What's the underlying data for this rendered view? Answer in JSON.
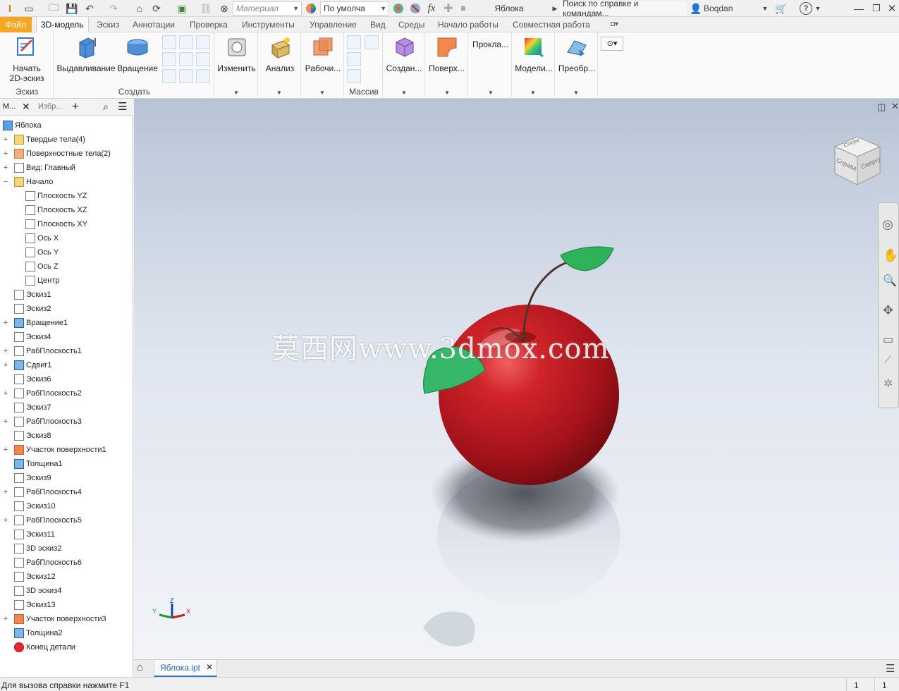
{
  "titlebar": {
    "material": "Материал",
    "appearance": "По умолча",
    "fx": "fx",
    "doc_title": "Яблока",
    "search_placeholder": "Поиск по справке и командам...",
    "user": "Boqdan"
  },
  "tabs": [
    "Файл",
    "3D-модель",
    "Эскиз",
    "Аннотации",
    "Проверка",
    "Инструменты",
    "Управление",
    "Вид",
    "Среды",
    "Начало работы",
    "Совместная работа"
  ],
  "ribbon": {
    "start_sketch": "Начать\n2D-эскиз",
    "sketch_panel": "Эскиз",
    "extrude": "Выдавливание",
    "revolve": "Вращение",
    "create_panel": "Создать",
    "modify": "Изменить",
    "analysis": "Анализ",
    "work": "Рабочи...",
    "pattern": "Массив",
    "create2": "Создан...",
    "surface": "Поверх...",
    "route": "Прокла...",
    "model": "Модели...",
    "convert": "Преобр..."
  },
  "browser": {
    "tab1": "М...",
    "tab2": "Избр...",
    "items": [
      {
        "label": "Яблока",
        "level": 0,
        "exp": ""
      },
      {
        "label": "Твердые тела(4)",
        "level": 1,
        "exp": "+"
      },
      {
        "label": "Поверхностные тела(2)",
        "level": 1,
        "exp": "+"
      },
      {
        "label": "Вид: Главный",
        "level": 1,
        "exp": "+"
      },
      {
        "label": "Начало",
        "level": 1,
        "exp": "−"
      },
      {
        "label": "Плоскость YZ",
        "level": 2,
        "exp": ""
      },
      {
        "label": "Плоскость XZ",
        "level": 2,
        "exp": ""
      },
      {
        "label": "Плоскость XY",
        "level": 2,
        "exp": ""
      },
      {
        "label": "Ось X",
        "level": 2,
        "exp": ""
      },
      {
        "label": "Ось Y",
        "level": 2,
        "exp": ""
      },
      {
        "label": "Ось Z",
        "level": 2,
        "exp": ""
      },
      {
        "label": "Центр",
        "level": 2,
        "exp": ""
      },
      {
        "label": "Эскиз1",
        "level": 1,
        "exp": ""
      },
      {
        "label": "Эскиз2",
        "level": 1,
        "exp": ""
      },
      {
        "label": "Вращение1",
        "level": 1,
        "exp": "+"
      },
      {
        "label": "Эскиз4",
        "level": 1,
        "exp": ""
      },
      {
        "label": "РабПлоскость1",
        "level": 1,
        "exp": "+"
      },
      {
        "label": "Сдвиг1",
        "level": 1,
        "exp": "+"
      },
      {
        "label": "Эскиз6",
        "level": 1,
        "exp": ""
      },
      {
        "label": "РабПлоскость2",
        "level": 1,
        "exp": "+"
      },
      {
        "label": "Эскиз7",
        "level": 1,
        "exp": ""
      },
      {
        "label": "РабПлоскость3",
        "level": 1,
        "exp": "+"
      },
      {
        "label": "Эскиз8",
        "level": 1,
        "exp": ""
      },
      {
        "label": "Участок поверхности1",
        "level": 1,
        "exp": "+"
      },
      {
        "label": "Толщина1",
        "level": 1,
        "exp": ""
      },
      {
        "label": "Эскиз9",
        "level": 1,
        "exp": ""
      },
      {
        "label": "РабПлоскость4",
        "level": 1,
        "exp": "+"
      },
      {
        "label": "Эскиз10",
        "level": 1,
        "exp": ""
      },
      {
        "label": "РабПлоскость5",
        "level": 1,
        "exp": "+"
      },
      {
        "label": "Эскиз11",
        "level": 1,
        "exp": ""
      },
      {
        "label": "3D эскиз2",
        "level": 1,
        "exp": ""
      },
      {
        "label": "РабПлоскость6",
        "level": 1,
        "exp": ""
      },
      {
        "label": "Эскиз12",
        "level": 1,
        "exp": ""
      },
      {
        "label": "3D эскиз4",
        "level": 1,
        "exp": ""
      },
      {
        "label": "Эскиз13",
        "level": 1,
        "exp": ""
      },
      {
        "label": "Участок поверхности3",
        "level": 1,
        "exp": "+"
      },
      {
        "label": "Толщина2",
        "level": 1,
        "exp": ""
      },
      {
        "label": "Конец детали",
        "level": 1,
        "exp": ""
      }
    ]
  },
  "viewport": {
    "watermark": "莫西网www.3dmox.com",
    "viewcube_front": "Спере",
    "viewcube_right": "Справа",
    "viewcube_top": "Сверху"
  },
  "doc_tab": "Яблока.ipt",
  "status": {
    "hint": "Для вызова справки нажмите F1",
    "num1": "1",
    "num2": "1"
  },
  "colors": {
    "file_tab": "#f5a623",
    "apple": "#b3141a",
    "leaf": "#2fb35a"
  }
}
